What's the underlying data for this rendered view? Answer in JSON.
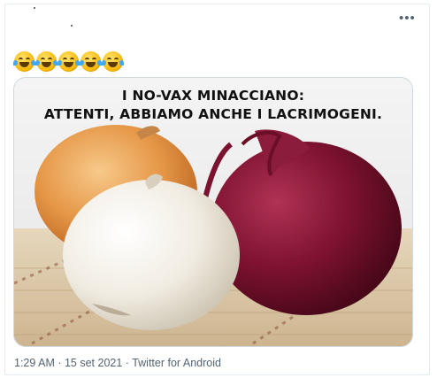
{
  "tweet": {
    "emojis": [
      "rolling-on-floor-laughing",
      "rolling-on-floor-laughing",
      "rolling-on-floor-laughing",
      "rolling-on-floor-laughing",
      "rolling-on-floor-laughing"
    ],
    "media": {
      "caption_line1": "I NO-VAX MINACCIANO:",
      "caption_line2": "ATTENTI, ABBIAMO ANCHE I LACRIMOGENI."
    },
    "timestamp": "1:29 AM · 15 set 2021",
    "separator": " · ",
    "source": "Twitter for Android"
  },
  "colors": {
    "border": "#e6ecf0",
    "muted_text": "#536471",
    "media_border": "#cfd9de"
  }
}
